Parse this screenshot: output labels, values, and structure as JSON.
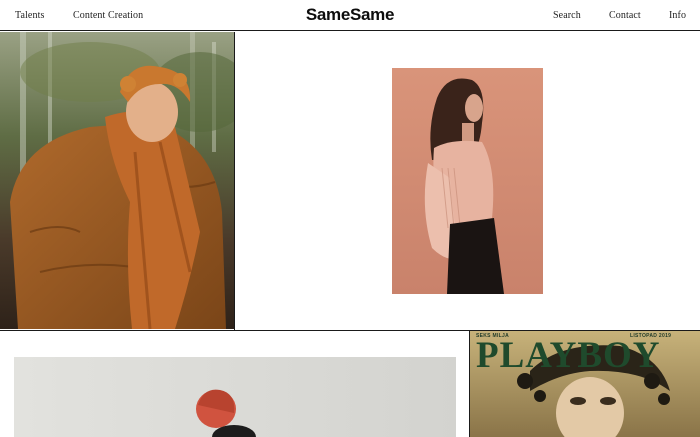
{
  "header": {
    "brand": "SameSame",
    "nav_left": [
      {
        "label": "Talents"
      },
      {
        "label": "Content Creation"
      }
    ],
    "nav_right": [
      {
        "label": "Search"
      },
      {
        "label": "Contact"
      },
      {
        "label": "Info"
      }
    ]
  },
  "gallery": {
    "magazine": {
      "brand": "PLAYBOY",
      "cover_line_left": "SEKS MILJA",
      "cover_line_right": "LISTOPAD 2019"
    }
  },
  "colors": {
    "rule": "#1a1a1a",
    "magazine_title": "#1f4a2c",
    "background": "#ffffff"
  }
}
